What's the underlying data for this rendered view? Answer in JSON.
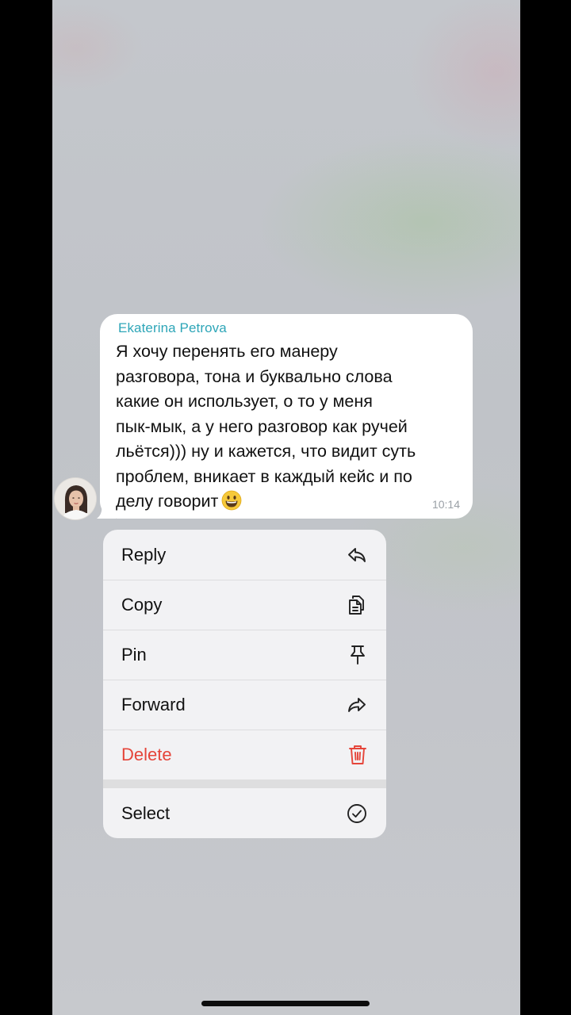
{
  "message": {
    "sender": "Ekaterina Petrova",
    "text": "Я хочу перенять его манеру\nразговора, тона и буквально слова\nкакие он использует, о то у меня\nпык-мык, а у него разговор как ручей\nльётся))) ну и кажется, что видит суть\nпроблем, вникает в каждый кейс и по\nделу говорит",
    "emoji": "grinning-face",
    "time": "10:14"
  },
  "menu": {
    "items": [
      {
        "label": "Reply",
        "icon": "reply-icon"
      },
      {
        "label": "Copy",
        "icon": "copy-icon"
      },
      {
        "label": "Pin",
        "icon": "pin-icon"
      },
      {
        "label": "Forward",
        "icon": "forward-icon"
      },
      {
        "label": "Delete",
        "icon": "trash-icon",
        "color": "#e5453a"
      },
      {
        "label": "Select",
        "icon": "check-circle-icon"
      }
    ]
  },
  "colors": {
    "sender": "#2ea6b8",
    "danger": "#e5453a",
    "menu_bg": "#f2f2f4"
  }
}
